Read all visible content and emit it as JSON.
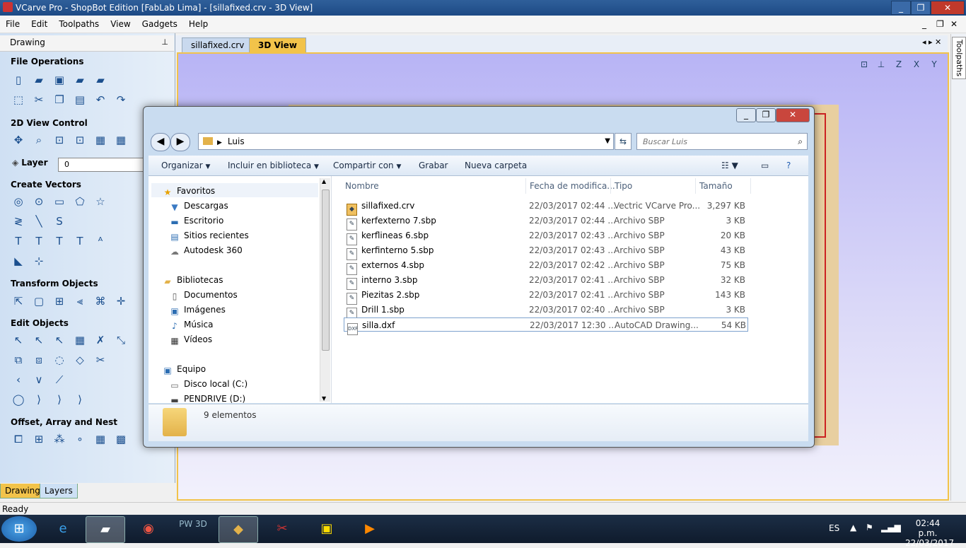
{
  "window": {
    "title": "VCarve Pro - ShopBot Edition [FabLab Lima] - [sillafixed.crv - 3D View]",
    "controls": [
      "_",
      "❐",
      "✕"
    ],
    "doc_controls": [
      "_",
      "❐",
      "✕"
    ]
  },
  "menu": [
    "File",
    "Edit",
    "Toolpaths",
    "View",
    "Gadgets",
    "Help"
  ],
  "left_panel": {
    "header": "Drawing",
    "pin": "⊥",
    "sections": {
      "file_operations": "File Operations",
      "view_control": "2D View Control",
      "layer": "Layer",
      "layer_value": "0",
      "create_vectors": "Create Vectors",
      "transform_objects": "Transform Objects",
      "edit_objects": "Edit Objects",
      "offset_array": "Offset, Array and Nest"
    },
    "bottom_tabs": [
      "Drawing",
      "Layers"
    ]
  },
  "doc_tabs": [
    "sillafixed.crv",
    "3D View"
  ],
  "right_tab": "Toolpaths",
  "status": "Ready",
  "explorer": {
    "address": "Luis",
    "search_placeholder": "Buscar Luis",
    "commands": [
      "Organizar",
      "Incluir en biblioteca",
      "Compartir con",
      "Grabar",
      "Nueva carpeta"
    ],
    "nav": {
      "favorites": "Favoritos",
      "fav_items": [
        "Descargas",
        "Escritorio",
        "Sitios recientes",
        "Autodesk 360"
      ],
      "libraries": "Bibliotecas",
      "lib_items": [
        "Documentos",
        "Imágenes",
        "Música",
        "Vídeos"
      ],
      "computer": "Equipo",
      "comp_items": [
        "Disco local (C:)",
        "PENDRIVE (D:)"
      ]
    },
    "columns": [
      "Nombre",
      "Fecha de modifica...",
      "Tipo",
      "Tamaño"
    ],
    "files": [
      {
        "name": "sillafixed.crv",
        "date": "22/03/2017 02:44 ...",
        "type": "Vectric VCarve Pro...",
        "size": "3,297 KB"
      },
      {
        "name": "kerfexterno 7.sbp",
        "date": "22/03/2017 02:44 ...",
        "type": "Archivo SBP",
        "size": "3 KB"
      },
      {
        "name": "kerflineas 6.sbp",
        "date": "22/03/2017 02:43 ...",
        "type": "Archivo SBP",
        "size": "20 KB"
      },
      {
        "name": "kerfinterno 5.sbp",
        "date": "22/03/2017 02:43 ...",
        "type": "Archivo SBP",
        "size": "43 KB"
      },
      {
        "name": "externos 4.sbp",
        "date": "22/03/2017 02:42 ...",
        "type": "Archivo SBP",
        "size": "75 KB"
      },
      {
        "name": "interno 3.sbp",
        "date": "22/03/2017 02:41 ...",
        "type": "Archivo SBP",
        "size": "32 KB"
      },
      {
        "name": "Piezitas 2.sbp",
        "date": "22/03/2017 02:41 ...",
        "type": "Archivo SBP",
        "size": "143 KB"
      },
      {
        "name": "Drill 1.sbp",
        "date": "22/03/2017 02:40 ...",
        "type": "Archivo SBP",
        "size": "3 KB"
      },
      {
        "name": "silla.dxf",
        "date": "22/03/2017 12:30 ...",
        "type": "AutoCAD Drawing...",
        "size": "54 KB"
      }
    ],
    "item_count": "9 elementos"
  },
  "taskbar": {
    "lang": "ES",
    "time": "02:44 p.m.",
    "date": "22/03/2017",
    "apps": [
      "pw3d-icon"
    ],
    "app_label": "PW 3D"
  }
}
